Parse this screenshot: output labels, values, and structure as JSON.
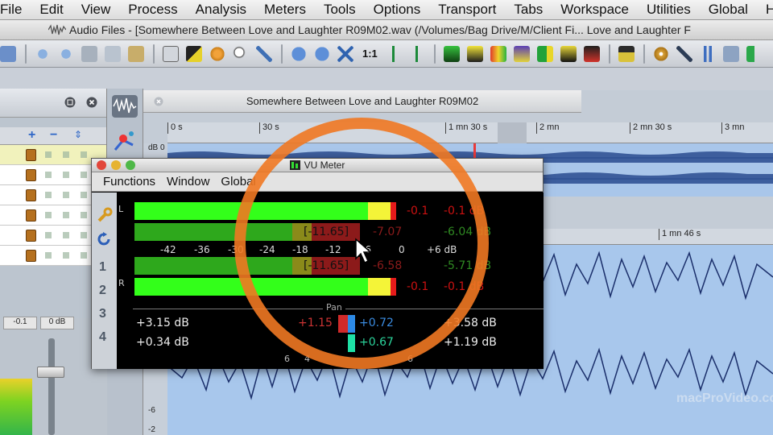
{
  "menu": [
    "File",
    "Edit",
    "View",
    "Process",
    "Analysis",
    "Meters",
    "Tools",
    "Options",
    "Transport",
    "Tabs",
    "Workspace",
    "Utilities",
    "Global",
    "Help"
  ],
  "window_title": "Audio Files - [Somewhere Between Love and Laughter R09M02.wav (/Volumes/Bag Drive/M/Client Fi... Love and Laughter F",
  "toolbar": {
    "ratio_label": "1:1"
  },
  "wave_window": {
    "title": "Somewhere Between Love and Laughter R09M02",
    "ruler_ticks": [
      "0 s",
      "30 s",
      "1 mn 30 s",
      "2 mn",
      "2 mn 30 s",
      "3 mn"
    ],
    "zoom_ruler_tick": "1 mn 46 s",
    "db_top_label": "dB 0",
    "db_labels": [
      "-6",
      "-2"
    ]
  },
  "left_panel": {
    "fader_values": [
      "-0.1",
      "0 dB"
    ]
  },
  "vu_meter": {
    "title": "VU Meter",
    "menu": [
      "Functions",
      "Window",
      "Global"
    ],
    "side_numbers": [
      "1",
      "2",
      "3",
      "4"
    ],
    "channel_left": "L",
    "channel_right": "R",
    "scale": [
      "-42",
      "-36",
      "-30",
      "-24",
      "-18",
      "-12",
      "-6",
      "0",
      "+6 dB"
    ],
    "left_peak_value": "-0.1",
    "left_peak_db": "-0.1 dB",
    "left_rms_bracket": "[-11.65]",
    "left_rms_value": "-7.07",
    "left_rms_db": "-6.04 dB",
    "right_rms_bracket": "[-11.65]",
    "right_rms_value": "-6.58",
    "right_rms_db": "-5.71 dB",
    "right_peak_value": "-0.1",
    "right_peak_db": "-0.1 dB",
    "pan_label": "Pan",
    "row1_left": "+3.15 dB",
    "row1_pan_left": "+1.15",
    "row1_pan_right": "+0.72",
    "row1_right": "+3.58 dB",
    "row2_left": "+0.34 dB",
    "row2_pan_right": "+0.67",
    "row2_right": "+1.19 dB",
    "pan_scale": [
      "6",
      "4",
      "6"
    ]
  },
  "watermark": "macProVideo.com",
  "colors": {
    "green": "#33ff1a",
    "dark_green": "#2ea81c",
    "yellow": "#f4f438",
    "red": "#e61b1b",
    "dark_red": "#8c1a1a",
    "orange_circle": "#f07822"
  }
}
